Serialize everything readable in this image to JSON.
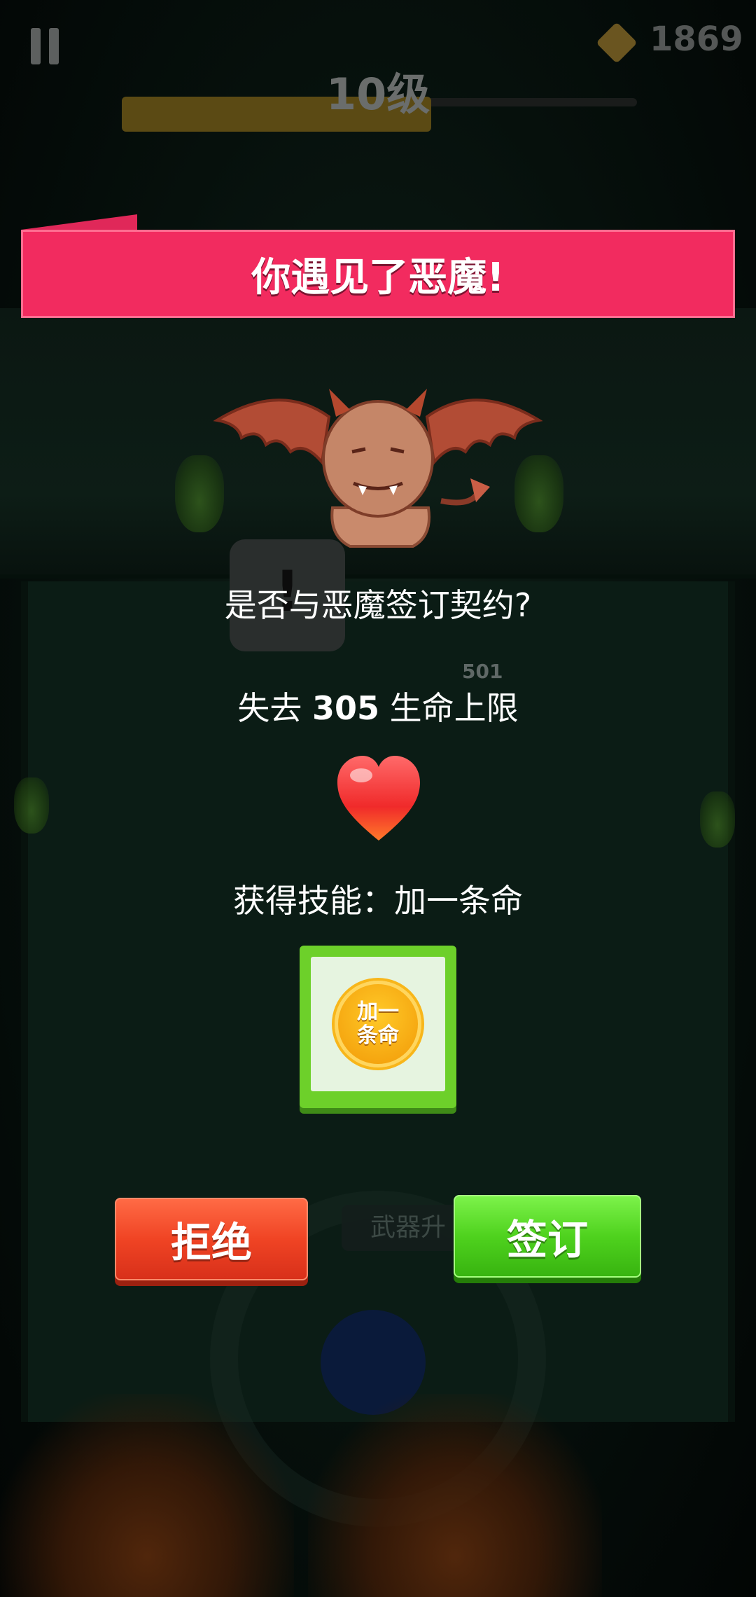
{
  "hud": {
    "pause_icon": "pause-icon",
    "gem_icon": "gem-icon",
    "gem_count": "1869",
    "level_label": "10级",
    "level_progress": 0.6
  },
  "background": {
    "weapon_upgrade_label": "武器升",
    "enemy_damage": "501",
    "alert_mark": "!"
  },
  "dialog": {
    "title": "你遇见了恶魔!",
    "demon_icon": "demon-icon",
    "question": "是否与恶魔签订契约?",
    "loss_prefix": "失去",
    "loss_amount": "305",
    "loss_suffix": "生命上限",
    "heart_icon": "heart-icon",
    "skill_label": "获得技能：加一条命",
    "skill_icon_line1": "加一",
    "skill_icon_line2": "条命",
    "refuse_button": "拒绝",
    "sign_button": "签订"
  },
  "colors": {
    "banner": "#f22b5f",
    "refuse": "#f04424",
    "sign": "#4fd21e",
    "skill_card": "#6dd02a"
  }
}
